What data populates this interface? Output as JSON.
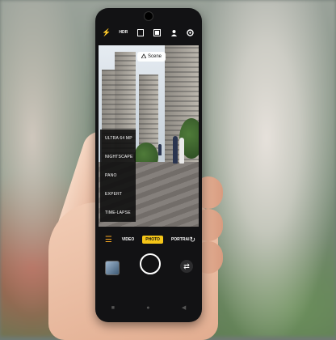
{
  "camera": {
    "scene_label": "Scene",
    "menu_items": [
      "ULTRA 64 MP",
      "NIGHTSCAPE",
      "PANO",
      "EXPERT",
      "TIME-LAPSE"
    ],
    "modes": [
      "VIDEO",
      "PHOTO",
      "PORTRAI"
    ],
    "active_mode": "PHOTO",
    "top_icons": [
      "flash-icon",
      "hdr-icon",
      "aspect-ratio-icon",
      "filter-icon",
      "beauty-icon",
      "settings-icon"
    ],
    "hdr_label": "HDR"
  },
  "colors": {
    "active_mode_bg": "#f5c518",
    "menu_icon": "#f5a623"
  }
}
